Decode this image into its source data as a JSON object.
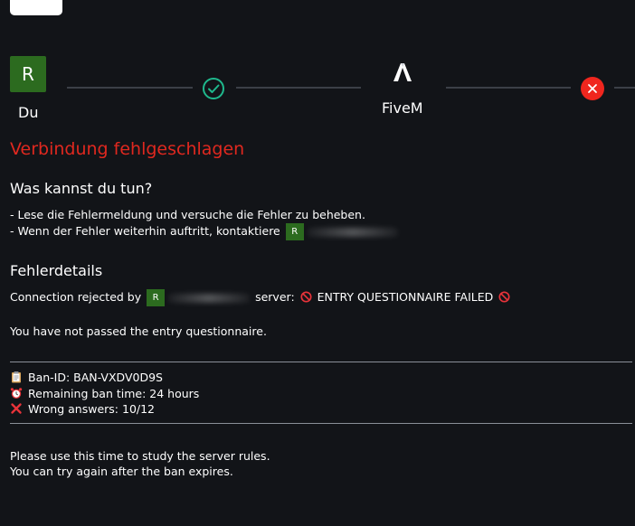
{
  "steps": {
    "user": {
      "avatar_letter": "R",
      "label": "Du"
    },
    "server": {
      "label": "FiveM"
    },
    "check_icon": "check-circle-icon",
    "fivem_icon": "fivem-logo-icon",
    "error_icon": "close-circle-icon"
  },
  "status": {
    "title": "Verbindung fehlgeschlagen"
  },
  "help": {
    "heading": "Was kannst du tun?",
    "line1": "- Lese die Fehlermeldung und versuche die Fehler zu beheben.",
    "line2_prefix": "- Wenn der Fehler weiterhin auftritt, kontaktiere",
    "contact_avatar_letter": "R"
  },
  "details": {
    "heading": "Fehlerdetails",
    "rejected_prefix": "Connection rejected by",
    "server_avatar_letter": "R",
    "server_label": "server:",
    "failure_text": "ENTRY QUESTIONNAIRE FAILED",
    "message": "You have not passed the entry questionnaire.",
    "ban_id": "Ban-ID: BAN-VXDV0D9S",
    "remaining": "Remaining ban time: 24 hours",
    "wrong": "Wrong answers: 10/12",
    "advice1": "Please use this time to study the server rules.",
    "advice2": "You can try again after the ban expires."
  },
  "colors": {
    "background": "#121418",
    "error_red": "#e0281f",
    "success_teal": "#1fb98d",
    "avatar_green": "#2c6b1f"
  }
}
